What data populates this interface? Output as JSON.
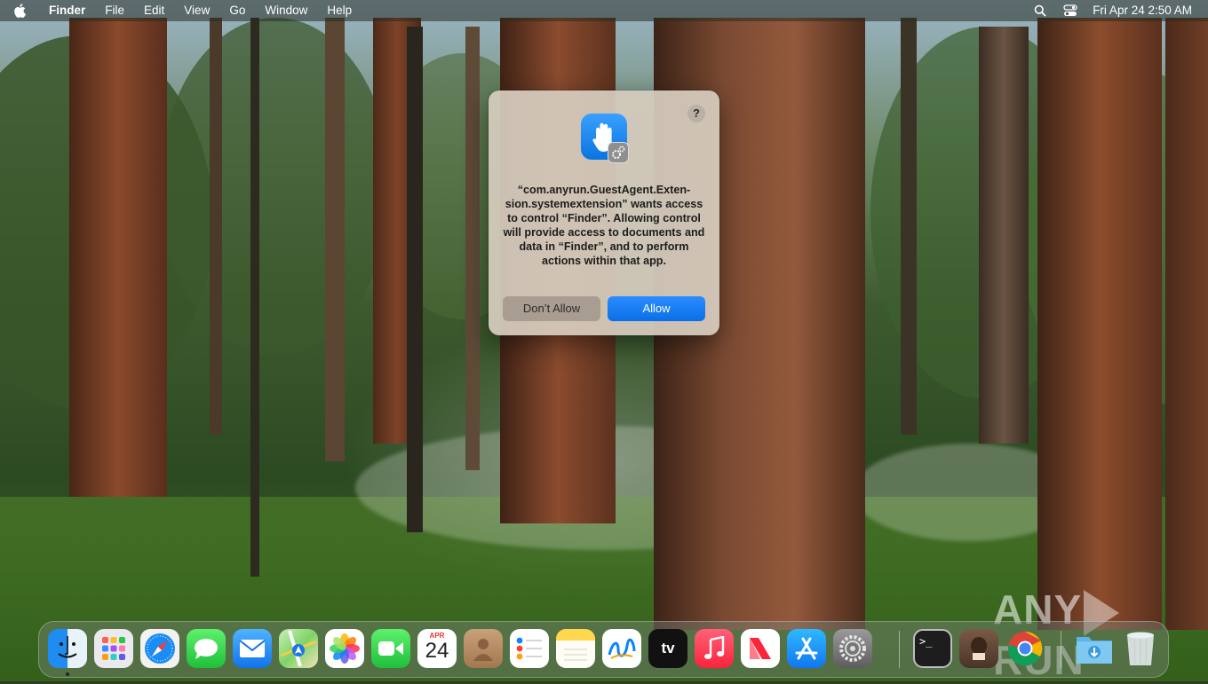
{
  "menubar": {
    "app_name": "Finder",
    "menus": [
      "File",
      "Edit",
      "View",
      "Go",
      "Window",
      "Help"
    ],
    "clock": "Fri Apr 24  2:50 AM",
    "right_icons": [
      "search-icon",
      "control-center-icon"
    ]
  },
  "dialog": {
    "help_label": "?",
    "message": "“com.anyrun.GuestAgent.Exten-sion.systemextension” wants access to control “Finder”. Allowing control will provide access to documents and data in “Finder”, and to perform actions within that app.",
    "deny_label": "Don’t Allow",
    "allow_label": "Allow",
    "icon": "privacy-hand-icon"
  },
  "watermark": {
    "left": "ANY",
    "right": "RUN"
  },
  "dock": {
    "calendar_month": "APR",
    "calendar_day": "24",
    "tv_label": "tv",
    "terminal_prompt": ">_",
    "apps": [
      "Finder",
      "Launchpad",
      "Safari",
      "Messages",
      "Mail",
      "Maps",
      "Photos",
      "FaceTime",
      "Calendar",
      "Contacts",
      "Reminders",
      "Notes",
      "Freeform",
      "TV",
      "Music",
      "News",
      "App Store",
      "System Settings",
      "Terminal",
      "Preview",
      "Chrome",
      "Downloads",
      "Trash"
    ]
  },
  "colors": {
    "accent": "#0a74e0",
    "dialog_bg": "#d6ccbe"
  }
}
